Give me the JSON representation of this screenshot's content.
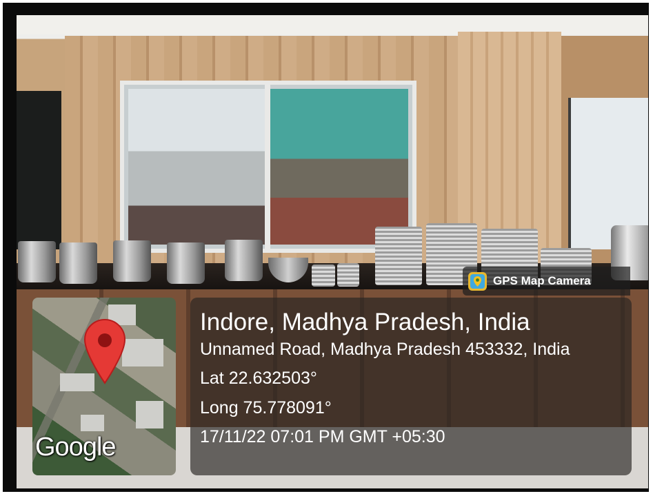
{
  "badge": {
    "label": "GPS Map Camera",
    "icon": "map-pin-app-icon"
  },
  "map": {
    "provider_label": "Google",
    "pin_color": "#e53935"
  },
  "location": {
    "city_line": "Indore, Madhya Pradesh, India",
    "address": "Unnamed Road, Madhya Pradesh 453332, India",
    "lat": "Lat 22.632503°",
    "long": "Long 75.778091°",
    "datetime": "17/11/22 07:01 PM GMT +05:30"
  }
}
